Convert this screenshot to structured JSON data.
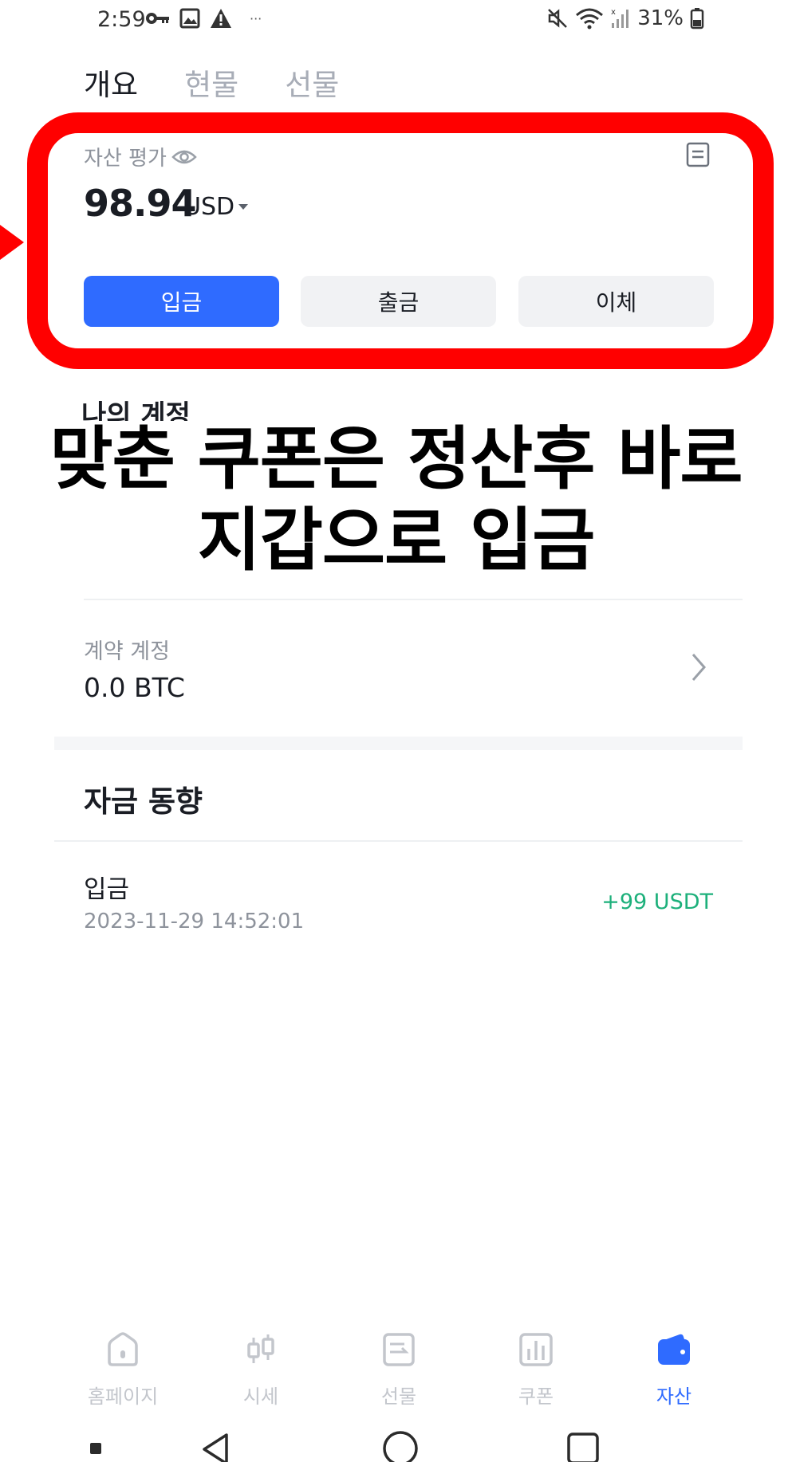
{
  "status_bar": {
    "time": "2:59",
    "battery": "31%",
    "overflow": "···"
  },
  "tabs": [
    {
      "label": "개요",
      "active": true
    },
    {
      "label": "현물",
      "active": false
    },
    {
      "label": "선물",
      "active": false
    }
  ],
  "asset": {
    "label": "자산 평가",
    "amount": "98.94",
    "unit": "USD"
  },
  "actions": {
    "deposit": "입금",
    "withdraw": "출금",
    "transfer": "이체"
  },
  "hidden_section_title": "나의 계정",
  "caption": {
    "line1": "맞춘 쿠폰은 정산후 바로",
    "line2": "지갑으로 입금"
  },
  "contract": {
    "label": "계약 계정",
    "value": "0.0 BTC"
  },
  "funds_flow": {
    "title": "자금 동향",
    "records": [
      {
        "type": "입금",
        "date": "2023-11-29 14:52:01",
        "amount": "+99 USDT"
      }
    ]
  },
  "bottom_nav": [
    {
      "label": "홈페이지",
      "icon": "home-icon",
      "active": false
    },
    {
      "label": "시세",
      "icon": "candlestick-icon",
      "active": false
    },
    {
      "label": "선물",
      "icon": "futures-icon",
      "active": false
    },
    {
      "label": "쿠폰",
      "icon": "coupon-chart-icon",
      "active": false
    },
    {
      "label": "자산",
      "icon": "wallet-icon",
      "active": true
    }
  ],
  "colors": {
    "accent": "#2f6bff",
    "highlight": "#ff0000",
    "positive": "#1db07b",
    "muted": "#8e939c"
  }
}
